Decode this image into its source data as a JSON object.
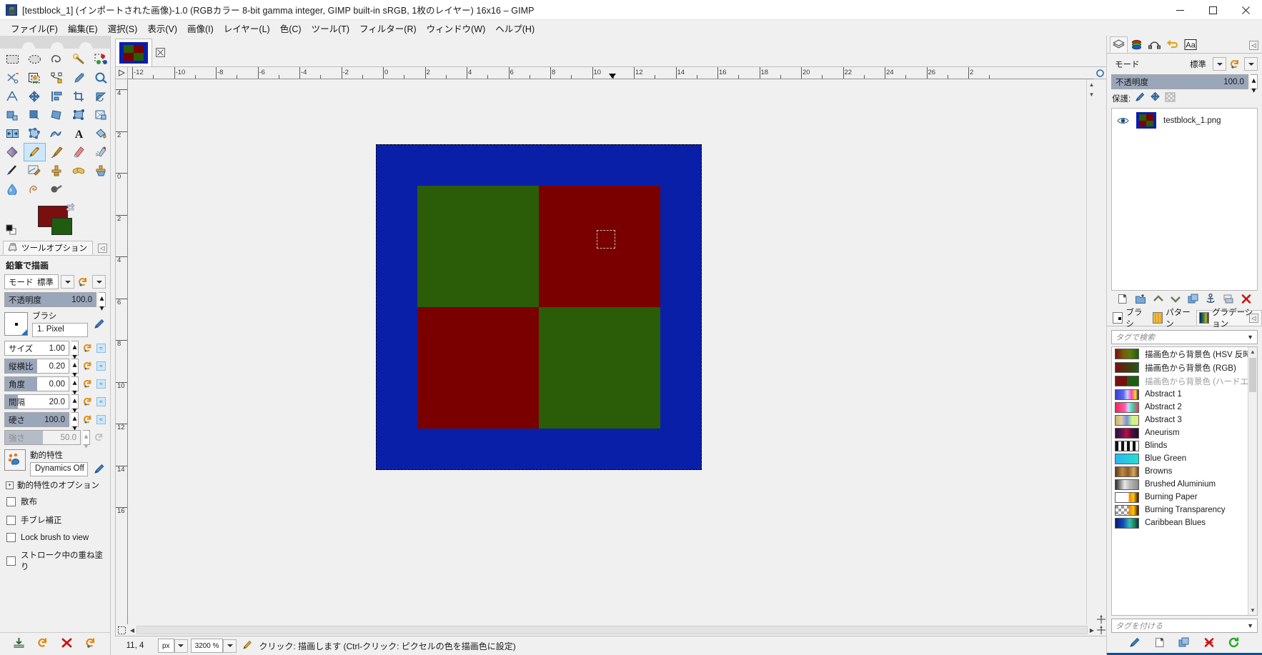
{
  "window": {
    "title": "[testblock_1] (インポートされた画像)-1.0 (RGBカラー 8-bit gamma integer, GIMP built-in sRGB, 1枚のレイヤー) 16x16 – GIMP",
    "minimize_label": "minimize",
    "maximize_label": "maximize",
    "close_label": "close"
  },
  "menubar": {
    "items": [
      {
        "label": "ファイル(F)"
      },
      {
        "label": "編集(E)"
      },
      {
        "label": "選択(S)"
      },
      {
        "label": "表示(V)"
      },
      {
        "label": "画像(I)"
      },
      {
        "label": "レイヤー(L)"
      },
      {
        "label": "色(C)"
      },
      {
        "label": "ツール(T)"
      },
      {
        "label": "フィルター(R)"
      },
      {
        "label": "ウィンドウ(W)"
      },
      {
        "label": "ヘルプ(H)"
      }
    ]
  },
  "toolbox": {
    "tools": [
      {
        "name": "rect-select-tool"
      },
      {
        "name": "ellipse-select-tool"
      },
      {
        "name": "free-select-tool"
      },
      {
        "name": "fuzzy-select-tool"
      },
      {
        "name": "select-by-color-tool"
      },
      {
        "name": "scissors-select-tool"
      },
      {
        "name": "foreground-select-tool"
      },
      {
        "name": "paths-tool"
      },
      {
        "name": "color-picker-tool"
      },
      {
        "name": "zoom-tool"
      },
      {
        "name": "measure-tool"
      },
      {
        "name": "move-tool"
      },
      {
        "name": "align-tool"
      },
      {
        "name": "crop-tool"
      },
      {
        "name": "rotate-tool"
      },
      {
        "name": "scale-tool"
      },
      {
        "name": "shear-tool"
      },
      {
        "name": "perspective-tool"
      },
      {
        "name": "unified-transform-tool"
      },
      {
        "name": "handle-transform-tool"
      },
      {
        "name": "flip-tool"
      },
      {
        "name": "cage-transform-tool"
      },
      {
        "name": "warp-transform-tool"
      },
      {
        "name": "text-tool"
      },
      {
        "name": "bucket-fill-tool"
      },
      {
        "name": "gradient-tool"
      },
      {
        "name": "pencil-tool"
      },
      {
        "name": "paintbrush-tool"
      },
      {
        "name": "eraser-tool"
      },
      {
        "name": "airbrush-tool"
      },
      {
        "name": "ink-tool"
      },
      {
        "name": "mypaint-brush-tool"
      },
      {
        "name": "clone-tool"
      },
      {
        "name": "heal-tool"
      },
      {
        "name": "perspective-clone-tool"
      },
      {
        "name": "blur-sharpen-tool"
      },
      {
        "name": "smudge-tool"
      },
      {
        "name": "dodge-burn-tool"
      }
    ],
    "selected_tool": "pencil-tool",
    "foreground_color": "#7a0f0f",
    "background_color": "#1f5c10"
  },
  "tool_options": {
    "tab_label": "ツールオプション",
    "title": "鉛筆で描画",
    "mode": {
      "label": "モード",
      "value": "標準"
    },
    "opacity": {
      "label": "不透明度",
      "value": "100.0",
      "fill_pct": 100
    },
    "brush": {
      "label": "ブラシ",
      "value": "1. Pixel"
    },
    "sliders": [
      {
        "label": "サイズ",
        "value": "1.00",
        "fill_pct": 0
      },
      {
        "label": "縦横比",
        "value": "0.20",
        "fill_pct": 50
      },
      {
        "label": "角度",
        "value": "0.00",
        "fill_pct": 50
      },
      {
        "label": "間隔",
        "value": "20.0",
        "fill_pct": 20
      },
      {
        "label": "硬さ",
        "value": "100.0",
        "fill_pct": 100
      },
      {
        "label": "強さ",
        "value": "50.0",
        "fill_pct": 50,
        "disabled": true
      }
    ],
    "dynamics": {
      "label": "動的特性",
      "value": "Dynamics Off"
    },
    "dynamics_options_label": "動的特性のオプション",
    "checkboxes": [
      {
        "label": "散布",
        "checked": false
      },
      {
        "label": "手ブレ補正",
        "checked": false
      },
      {
        "label": "Lock brush to view",
        "checked": false
      },
      {
        "label": "ストローク中の重ね塗り",
        "checked": false
      }
    ],
    "footer_buttons": [
      {
        "name": "save-tool-options-icon"
      },
      {
        "name": "restore-tool-options-icon"
      },
      {
        "name": "delete-tool-options-icon"
      },
      {
        "name": "reset-tool-options-icon"
      }
    ]
  },
  "canvas": {
    "tab_name": "image-tab-testblock_1",
    "h_ruler_labels": [
      "-12",
      "-10",
      "-8",
      "-6",
      "-4",
      "-2",
      "0",
      "2",
      "4",
      "6",
      "8",
      "10",
      "12",
      "14",
      "16",
      "18",
      "20",
      "22",
      "24",
      "26",
      "2"
    ],
    "v_ruler_labels": [
      "4",
      "2",
      "0",
      "2",
      "4",
      "6",
      "8",
      "10",
      "12",
      "14",
      "16"
    ],
    "image_border_color": "#0a1fa8",
    "quadrant_colors": {
      "top_left": "#2b5c08",
      "top_right": "#7a0000",
      "bottom_left": "#7a0000",
      "bottom_right": "#2b5c08"
    },
    "pencil_cursor": {
      "label": "pencil-preview-outline"
    }
  },
  "statusbar": {
    "position": "11, 4",
    "unit": "px",
    "zoom": "3200 %",
    "message": "クリック: 描画します (Ctrl-クリック: ピクセルの色を描画色に設定)"
  },
  "layers_dock": {
    "tabs": [
      {
        "name": "tab-layers",
        "label": "レイヤー",
        "selected": true
      },
      {
        "name": "tab-channels",
        "label": "チャンネル",
        "selected": false
      },
      {
        "name": "tab-paths",
        "label": "パス",
        "selected": false
      },
      {
        "name": "tab-undo-history",
        "label": "作業履歴",
        "selected": false
      },
      {
        "name": "tab-pointer",
        "label": "Aa",
        "selected": false
      }
    ],
    "mode": {
      "label": "モード",
      "value": "標準"
    },
    "opacity": {
      "label": "不透明度",
      "value": "100.0",
      "fill_pct": 100
    },
    "lock": {
      "label": "保護:",
      "items": [
        "lock-pixels-icon",
        "lock-position-icon",
        "lock-alpha-icon"
      ]
    },
    "layers": [
      {
        "name": "testblock_1.png",
        "visible": true
      }
    ],
    "buttons": [
      {
        "name": "new-layer-button"
      },
      {
        "name": "new-layer-group-button"
      },
      {
        "name": "raise-layer-button"
      },
      {
        "name": "lower-layer-button"
      },
      {
        "name": "duplicate-layer-button"
      },
      {
        "name": "anchor-layer-button"
      },
      {
        "name": "merge-down-button"
      },
      {
        "name": "delete-layer-button"
      }
    ]
  },
  "brushes_dock": {
    "tabs": [
      {
        "name": "tab-brushes",
        "label": "ブラシ",
        "selected": false
      },
      {
        "name": "tab-patterns",
        "label": "パターン",
        "selected": false
      },
      {
        "name": "tab-gradients",
        "label": "グラデーション",
        "selected": true
      }
    ],
    "search_placeholder": "タグで検索",
    "tag_placeholder": "タグを付ける",
    "gradients": [
      {
        "label": "描画色から背景色 (HSV 反時計回り)",
        "dim": false,
        "grad": "linear-gradient(90deg,#7a0f0f,#7a5a0f 35%,#5a7a0f 65%,#1f5c10)"
      },
      {
        "label": "描画色から背景色 (RGB)",
        "dim": false,
        "grad": "linear-gradient(90deg,#7a0f0f,#4a3610 50%,#1f5c10)"
      },
      {
        "label": "描画色から背景色 (ハードエッジ)",
        "dim": true,
        "grad": "linear-gradient(90deg,#7a0f0f 0 50%,#1f5c10 50% 100%)"
      },
      {
        "label": "Abstract 1",
        "dim": false,
        "grad": "linear-gradient(90deg,#3b3bd4,#5b6ee8 35%,#d0d0ff 52%,#ff3ec8 70%,#ffe400 88%,#1a1a80)"
      },
      {
        "label": "Abstract 2",
        "dim": false,
        "grad": "linear-gradient(90deg,#f0255e,#ff5aa0 40%,#cfd5ff 56%,#35d6a0 75%,#ff2a6a)"
      },
      {
        "label": "Abstract 3",
        "dim": false,
        "grad": "linear-gradient(90deg,#c8b06a,#e0d0a0 25%,#7a8fe0 50%,#c0ff80 72%,#f0e090)"
      },
      {
        "label": "Aneurism",
        "dim": false,
        "grad": "linear-gradient(90deg,#2a1030,#6a1060 30%,#c01030 48%,#50104a 70%,#201020)"
      },
      {
        "label": "Blinds",
        "dim": false,
        "grad": "repeating-linear-gradient(90deg,#111 0 4px,#f2f2f2 4px 8px)"
      },
      {
        "label": "Blue Green",
        "dim": false,
        "grad": "linear-gradient(90deg,#2bb5f0,#22e0d0)"
      },
      {
        "label": "Browns",
        "dim": false,
        "grad": "linear-gradient(90deg,#5a3a18,#c08a40 30%,#8a5a28 55%,#d8a860 80%,#6a4020)"
      },
      {
        "label": "Brushed Aluminium",
        "dim": false,
        "grad": "linear-gradient(90deg,#2a2a2a,#e8e8e8 40%,#bdbdbd 60%,#8a8a8a)"
      },
      {
        "label": "Burning Paper",
        "dim": false,
        "grad": "linear-gradient(90deg,#ffffff 0 55%,#ff8000 62%,#ffd000 78%,#401000 100%)"
      },
      {
        "label": "Burning Transparency",
        "dim": false,
        "grad": "linear-gradient(90deg,rgba(0,0,0,0) 0 55%,#ff8000 62%,#ffd000 78%,#401000 100%)"
      },
      {
        "label": "Caribbean Blues",
        "dim": false,
        "grad": "linear-gradient(90deg,#0a1a6a,#1050c0 35%,#30c0b0 62%,#1a7a50 85%,#0a2a40)"
      }
    ],
    "buttons": [
      {
        "name": "edit-gradient-button"
      },
      {
        "name": "new-gradient-button"
      },
      {
        "name": "duplicate-gradient-button"
      },
      {
        "name": "delete-gradient-button"
      },
      {
        "name": "refresh-gradients-button"
      }
    ]
  }
}
